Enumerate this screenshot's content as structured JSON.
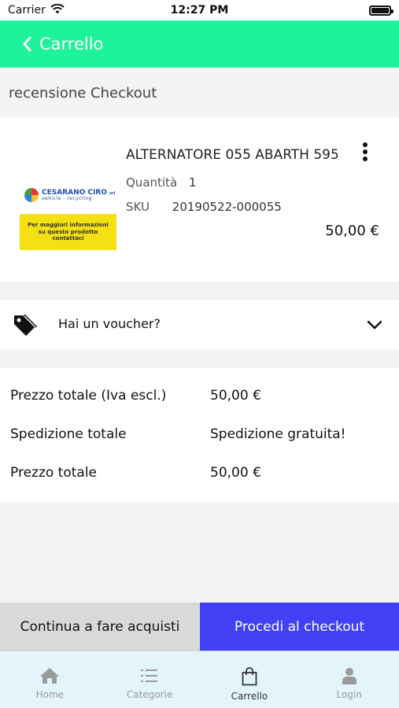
{
  "status_bar": {
    "carrier": "Carrier",
    "time": "12:27 PM"
  },
  "header": {
    "title": "Carrello"
  },
  "page": {
    "subtitle": "recensione Checkout"
  },
  "product": {
    "name": "ALTERNATORE 055 ABARTH 595",
    "quantity_label": "Quantità",
    "quantity": "1",
    "sku_label": "SKU",
    "sku": "20190522-000055",
    "price": "50,00 €",
    "image": {
      "logo_name": "CESARANO CIRO",
      "logo_suffix": "srl",
      "logo_sub": "vehicle - recycling",
      "banner_text": "Per maggiori informazioni su questo prodotto contattaci"
    }
  },
  "voucher": {
    "label": "Hai un voucher?"
  },
  "totals": [
    {
      "label": "Prezzo totale (Iva escl.)",
      "value": "50,00 €"
    },
    {
      "label": "Spedizione totale",
      "value": "Spedizione gratuita!"
    },
    {
      "label": "Prezzo totale",
      "value": "50,00 €"
    }
  ],
  "actions": {
    "continue_label": "Continua a fare acquisti",
    "checkout_label": "Procedi al checkout"
  },
  "tabs": [
    {
      "label": "Home",
      "icon": "home-icon",
      "active": false
    },
    {
      "label": "Categorie",
      "icon": "list-icon",
      "active": false
    },
    {
      "label": "Carrello",
      "icon": "bag-icon",
      "active": true
    },
    {
      "label": "Login",
      "icon": "user-icon",
      "active": false
    }
  ],
  "colors": {
    "header": "#1ef29a",
    "checkout_button": "#4140f5",
    "continue_button": "#d9d9d9",
    "tab_bar": "#e4f4fb"
  }
}
